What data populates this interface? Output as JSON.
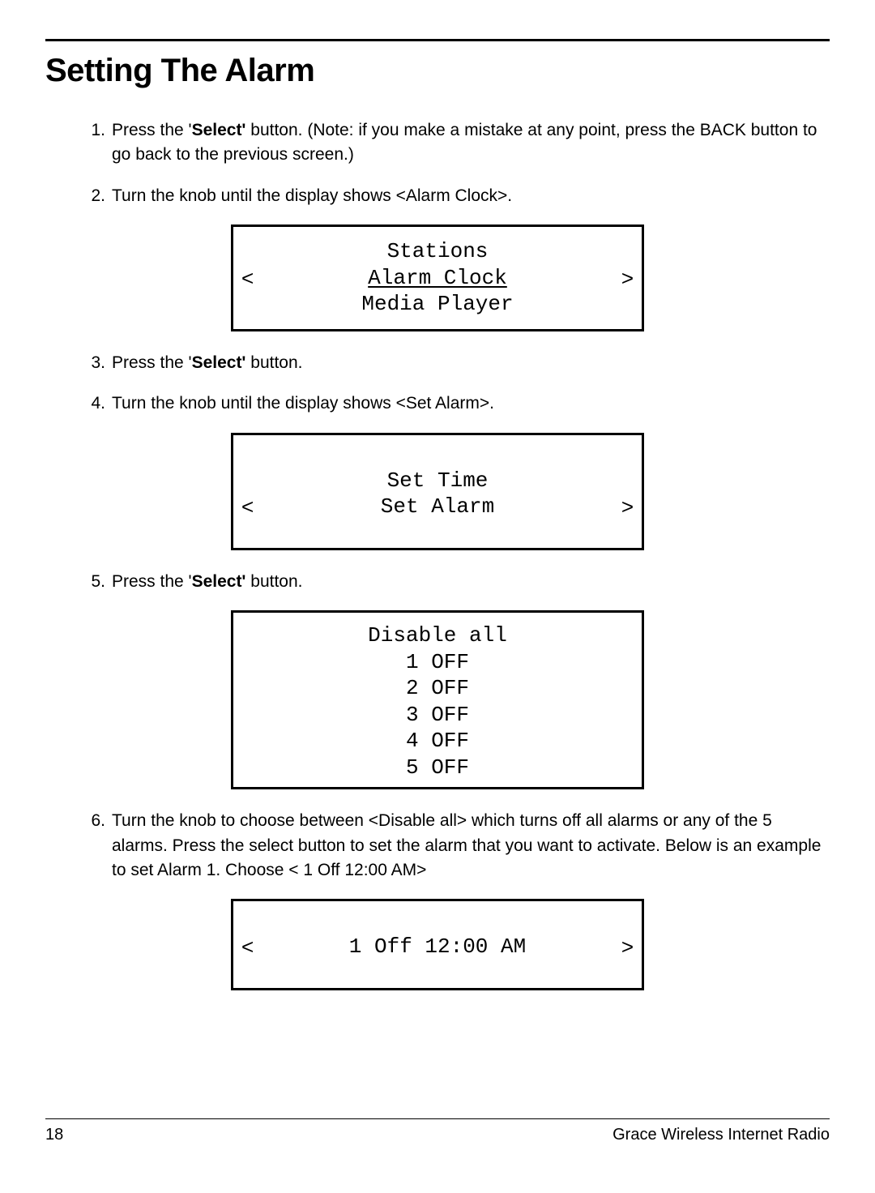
{
  "title": "Setting The Alarm",
  "steps": {
    "s1": {
      "num": "1.",
      "pre": "Press the '",
      "bold": "Select'",
      "post": " button. (Note: if you make a mistake at any point, press the BACK button to go back to the previous screen.)"
    },
    "s2": {
      "num": "2.",
      "text": "Turn the knob until the display shows <Alarm Clock>."
    },
    "s3": {
      "num": "3.",
      "pre": "Press the '",
      "bold": "Select'",
      "post": " button."
    },
    "s4": {
      "num": "4.",
      "text": "Turn the knob until the display shows <Set Alarm>."
    },
    "s5": {
      "num": "5.",
      "pre": "Press the '",
      "bold": "Select'",
      "post": " button."
    },
    "s6": {
      "num": "6.",
      "text": "Turn the knob to choose between <Disable all> which turns off all alarms or any of the 5 alarms.  Press the select button to set the alarm that you want to activate. Below is an example to set Alarm 1. Choose < 1 Off 12:00 AM>"
    }
  },
  "display1": {
    "line1": "Stations",
    "arrowL": "<",
    "selected": "Alarm Clock",
    "arrowR": ">",
    "line3": "Media Player"
  },
  "display2": {
    "line1": "Set Time",
    "arrowL": "<",
    "selected": "Set Alarm",
    "arrowR": ">"
  },
  "display3": {
    "line1": "Disable all",
    "line2": "1 OFF",
    "line3": "2 OFF",
    "line4": "3 OFF",
    "line5": "4 OFF",
    "line6": "5 OFF"
  },
  "display4": {
    "arrowL": "<",
    "selected": "1 Off 12:00 AM",
    "arrowR": ">"
  },
  "footer": {
    "page": "18",
    "product": "Grace Wireless Internet Radio"
  }
}
